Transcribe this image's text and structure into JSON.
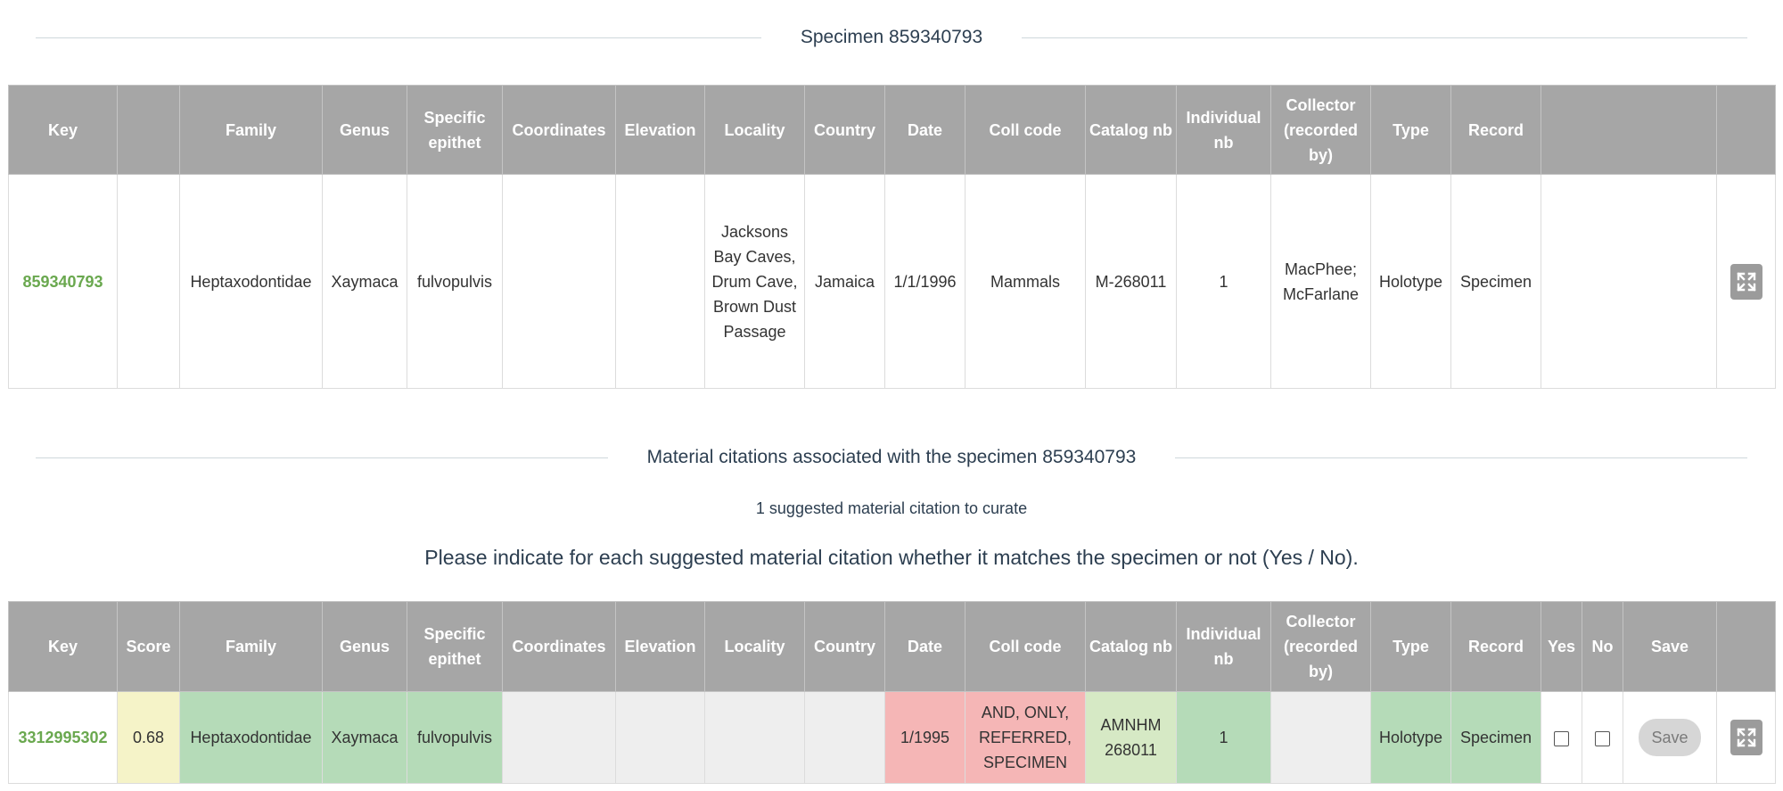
{
  "specimen_section": {
    "title": "Specimen 859340793",
    "headers": [
      "Key",
      "",
      "Family",
      "Genus",
      "Specific epithet",
      "Coordinates",
      "Elevation",
      "Locality",
      "Country",
      "Date",
      "Coll code",
      "Catalog nb",
      "Individual nb",
      "Collector (recorded by)",
      "Type",
      "Record",
      ""
    ],
    "row": {
      "key": "859340793",
      "score": "",
      "family": "Heptaxodontidae",
      "genus": "Xaymaca",
      "specific_epithet": "fulvopulvis",
      "coordinates": "",
      "elevation": "",
      "locality": "Jacksons Bay Caves, Drum Cave, Brown Dust Passage",
      "country": "Jamaica",
      "date": "1/1/1996",
      "coll_code": "Mammals",
      "catalog_nb": "M-268011",
      "individual_nb": "1",
      "collector": "MacPhee; McFarlane",
      "type": "Holotype",
      "record": "Specimen",
      "extra": ""
    }
  },
  "citations_section": {
    "title": "Material citations associated with the specimen 859340793",
    "suggested_count": "1 suggested material citation to curate",
    "instruction": "Please indicate for each suggested material citation whether it matches the specimen or not (Yes / No).",
    "headers": [
      "Key",
      "Score",
      "Family",
      "Genus",
      "Specific epithet",
      "Coordinates",
      "Elevation",
      "Locality",
      "Country",
      "Date",
      "Coll code",
      "Catalog nb",
      "Individual nb",
      "Collector (recorded by)",
      "Type",
      "Record",
      "Yes",
      "No",
      "Save",
      ""
    ],
    "row": {
      "key": "3312995302",
      "score": "0.68",
      "family": "Heptaxodontidae",
      "genus": "Xaymaca",
      "specific_epithet": "fulvopulvis",
      "coordinates": "",
      "elevation": "",
      "locality": "",
      "country": "",
      "date": "1/1995",
      "coll_code": "AND, ONLY, REFERRED, SPECIMEN",
      "catalog_nb": "AMNHM 268011",
      "individual_nb": "1",
      "collector": "",
      "type": "Holotype",
      "record": "Specimen",
      "yes_checked": false,
      "no_checked": false,
      "save_label": "Save"
    }
  },
  "icons": {
    "expand": "expand-arrows-icon"
  },
  "colors": {
    "header_bg": "#a6a6a6",
    "key_link": "#6aa84f",
    "match_green": "#b5dbb8",
    "partial_green": "#d6e9c5",
    "score_yellow": "#f5f3c8",
    "mismatch_red": "#f5b6b6",
    "missing_gray": "#eeeeee"
  }
}
